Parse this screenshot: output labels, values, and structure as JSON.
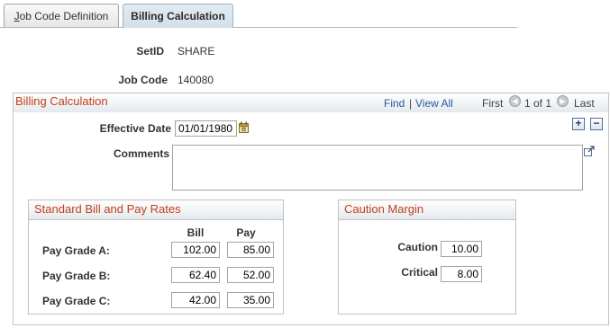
{
  "tabs": [
    {
      "label": "Job Code Definition",
      "mnemonic": "J",
      "rest": "ob Code Definition",
      "active": false
    },
    {
      "label": "Billing Calculation",
      "active": true
    }
  ],
  "header": {
    "setid_label": "SetID",
    "setid_value": "SHARE",
    "jobcode_label": "Job Code",
    "jobcode_value": "140080"
  },
  "billing": {
    "title": "Billing Calculation",
    "find": "Find",
    "separator": "|",
    "view_all": "View All",
    "first": "First",
    "range": "1 of 1",
    "last": "Last",
    "add": "+",
    "remove": "−",
    "effdate_label": "Effective Date",
    "effdate_value": "01/01/1980",
    "comments_label": "Comments",
    "comments_value": ""
  },
  "rates": {
    "title": "Standard Bill and Pay Rates",
    "col_bill": "Bill",
    "col_pay": "Pay",
    "rows": [
      {
        "label": "Pay Grade A:",
        "bill": "102.00",
        "pay": "85.00"
      },
      {
        "label": "Pay Grade B:",
        "bill": "62.40",
        "pay": "52.00"
      },
      {
        "label": "Pay Grade C:",
        "bill": "42.00",
        "pay": "35.00"
      }
    ]
  },
  "caution": {
    "title": "Caution Margin",
    "caution_label": "Caution",
    "caution_value": "10.00",
    "critical_label": "Critical",
    "critical_value": "8.00"
  },
  "icons": {
    "calendar": "calendar-icon",
    "expand": "expand-textarea-icon",
    "prev": "previous-arrow-icon",
    "next": "next-arrow-icon"
  }
}
